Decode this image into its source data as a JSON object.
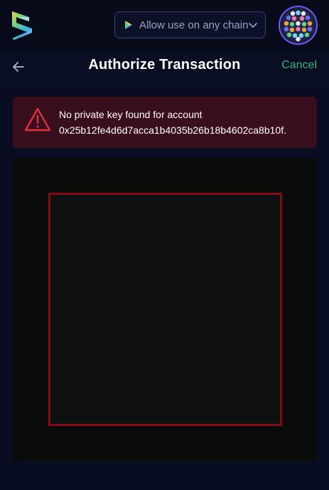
{
  "topbar": {
    "chain_select_label": "Allow use on any chain",
    "chain_icon": "network-icon",
    "chevron_icon": "chevron-down-icon",
    "logo_icon": "app-logo-icon",
    "avatar_icon": "account-avatar"
  },
  "header": {
    "title": "Authorize Transaction",
    "cancel_label": "Cancel",
    "back_icon": "arrow-left-icon"
  },
  "alert": {
    "icon": "warning-icon",
    "line1": "No private key found for account",
    "line2": "0x25b12fe4d6d7acca1b4035b26b18b4602ca8b10f."
  },
  "colors": {
    "background": "#080b1a",
    "accent_green": "#37b27a",
    "alert_bg": "#3a0f1d",
    "alert_icon": "#e0303a",
    "scan_frame": "#860b12",
    "select_border": "#3b4272"
  }
}
